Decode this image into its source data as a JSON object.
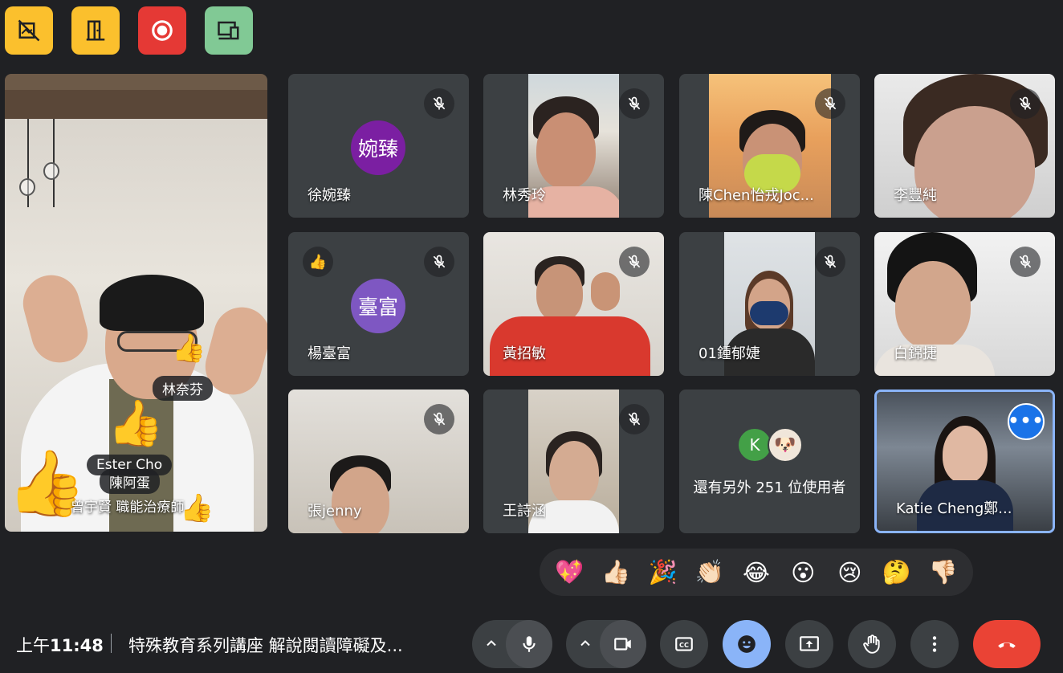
{
  "host_controls": [
    {
      "name": "lock-icon-1"
    },
    {
      "name": "exit-door-icon"
    },
    {
      "name": "record-icon"
    },
    {
      "name": "present-devices-icon"
    }
  ],
  "speaker": {
    "bubbles": [
      "林奈芬",
      "Ester Cho",
      "陳阿蛋",
      "曾宇賢 職能治療師"
    ]
  },
  "tiles": [
    {
      "name": "徐婉臻",
      "avatar": "婉臻",
      "avatar_color": "#7b1fa2"
    },
    {
      "name": "林秀玲"
    },
    {
      "name": "陳Chen怡戎Joc..."
    },
    {
      "name": "李豐純"
    },
    {
      "name": "楊臺富",
      "avatar": "臺富",
      "avatar_color": "#7e57c2",
      "reaction": "👍"
    },
    {
      "name": "黃招敏"
    },
    {
      "name": "01鍾郁婕"
    },
    {
      "name": "白錦捷"
    },
    {
      "name": "張jenny"
    },
    {
      "name": "王詩涵"
    },
    {
      "others_text": "還有另外 251 位使用者",
      "others_avatar": "K",
      "others_color": "#43a047"
    },
    {
      "name": "Katie Cheng鄭..."
    }
  ],
  "reactions": [
    "💖",
    "👍🏻",
    "🎉",
    "👏🏻",
    "😂",
    "😮",
    "😢",
    "🤔",
    "👎🏻"
  ],
  "bottom": {
    "time_prefix": "上午",
    "time": "11:48",
    "meeting_title": "特殊教育系列講座 解說閱讀障礙及..."
  },
  "colors": {
    "background": "#202124",
    "tile": "#3c4043",
    "accent_blue": "#8ab4f8",
    "hangup_red": "#ea4335"
  }
}
